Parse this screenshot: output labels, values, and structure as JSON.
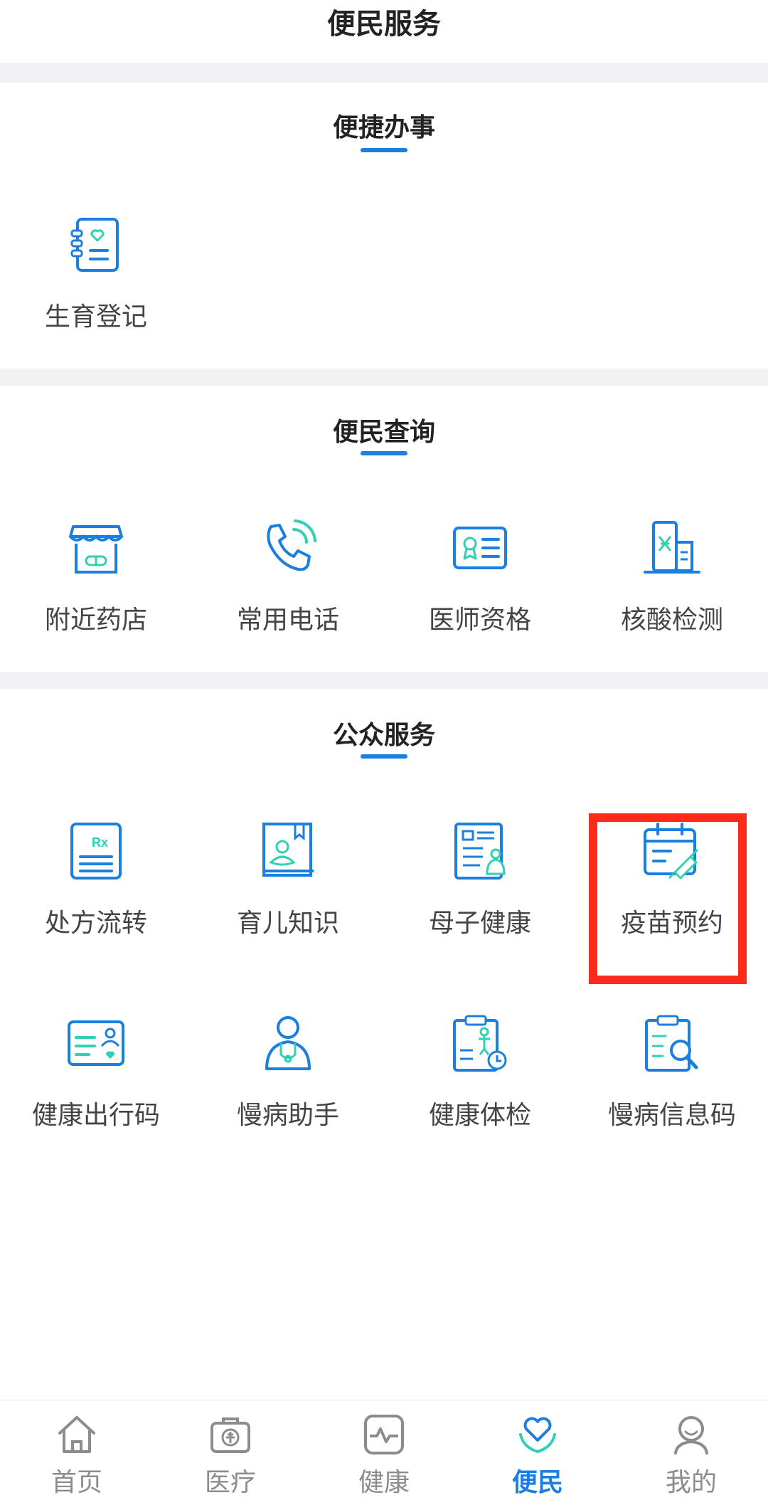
{
  "header": {
    "title": "便民服务"
  },
  "sections": [
    {
      "title": "便捷办事",
      "items": [
        {
          "label": "生育登记",
          "icon": "maternity-book-icon"
        }
      ]
    },
    {
      "title": "便民查询",
      "items": [
        {
          "label": "附近药店",
          "icon": "pharmacy-store-icon"
        },
        {
          "label": "常用电话",
          "icon": "phone-icon"
        },
        {
          "label": "医师资格",
          "icon": "certificate-icon"
        },
        {
          "label": "核酸检测",
          "icon": "dna-test-icon"
        }
      ]
    },
    {
      "title": "公众服务",
      "items": [
        {
          "label": "处方流转",
          "icon": "prescription-icon"
        },
        {
          "label": "育儿知识",
          "icon": "parenting-book-icon"
        },
        {
          "label": "母子健康",
          "icon": "mother-child-icon"
        },
        {
          "label": "疫苗预约",
          "icon": "vaccine-calendar-icon"
        },
        {
          "label": "健康出行码",
          "icon": "health-code-card-icon"
        },
        {
          "label": "慢病助手",
          "icon": "doctor-icon"
        },
        {
          "label": "健康体检",
          "icon": "checkup-clipboard-icon"
        },
        {
          "label": "慢病信息码",
          "icon": "search-clipboard-icon"
        }
      ]
    }
  ],
  "tabbar": {
    "active": "便民",
    "items": [
      {
        "label": "首页",
        "icon": "home-icon"
      },
      {
        "label": "医疗",
        "icon": "medical-kit-icon"
      },
      {
        "label": "健康",
        "icon": "heart-monitor-icon"
      },
      {
        "label": "便民",
        "icon": "heart-hands-icon"
      },
      {
        "label": "我的",
        "icon": "user-icon"
      }
    ]
  },
  "colors": {
    "accent": "#1a7fe0",
    "teal": "#2fd0b4",
    "highlight": "#ff2a1a"
  }
}
